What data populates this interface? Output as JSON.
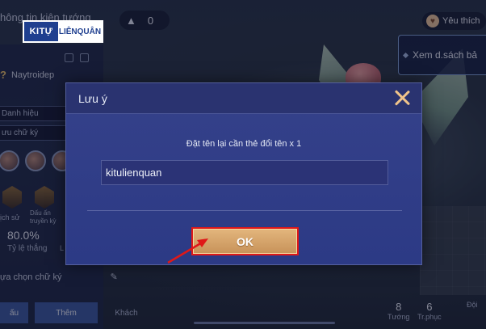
{
  "top": {
    "partial_title": "hông tin kiện tướng",
    "gem_count": "0",
    "like_label": "Yêu thích",
    "view_list_label": "Xem d.sách bả"
  },
  "watermark": {
    "left": "KITỰ",
    "right": "LIÊNQUÂN"
  },
  "profile": {
    "name": "Naytroidep",
    "title_row": "Danh hiệu",
    "signature_row": "ưu chữ ký",
    "history_label": "ịch sử",
    "mark_label": "Dấu ấn\ntruyền kỳ",
    "win_rate_value": "80.0%",
    "win_rate_label": "Tỷ lệ thắng",
    "choose_signature": "ựa chọn chữ ký",
    "cut_letter": "L",
    "tabs": [
      "ấu",
      "Thêm",
      "Khách"
    ]
  },
  "counters": [
    {
      "value": "8",
      "label": "Tướng"
    },
    {
      "value": "6",
      "label": "Tr.phục"
    },
    {
      "value": "",
      "label": "Đội"
    }
  ],
  "dialog": {
    "title": "Lưu ý",
    "message": "Đặt tên lại cần thẻ đổi tên x 1",
    "input_value": "kitulienquan",
    "ok_label": "OK"
  },
  "colors": {
    "dialog_bg": "#2f3c88",
    "ok_button": "#d6a46a",
    "highlight_border": "#e01818",
    "close_icon": "#f0c48a"
  }
}
